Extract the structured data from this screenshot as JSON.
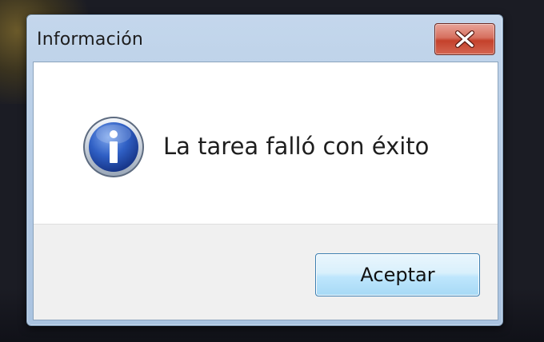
{
  "window": {
    "title": "Información",
    "close_icon": "close-icon"
  },
  "dialog": {
    "icon": "info-icon",
    "message": "La tarea falló con éxito",
    "ok_label": "Aceptar"
  },
  "colors": {
    "titlebar": "#b7cde6",
    "close_button": "#c4412b",
    "info_icon": "#1f4fb0",
    "button_bar": "#f0f0f0",
    "ok_button_border": "#3c7fb1"
  }
}
